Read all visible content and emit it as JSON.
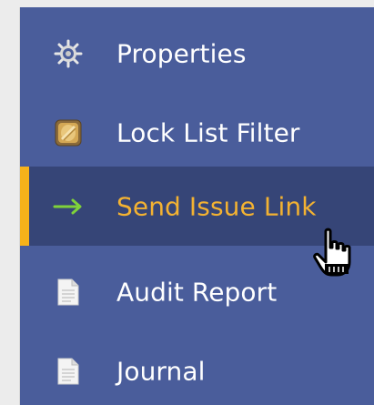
{
  "menu": {
    "items": [
      {
        "label": "Properties",
        "icon": "gear-icon"
      },
      {
        "label": "Lock List Filter",
        "icon": "lock-icon"
      },
      {
        "label": "Send Issue Link",
        "icon": "arrow-right-icon",
        "active": true
      },
      {
        "label": "Audit Report",
        "icon": "document-icon"
      },
      {
        "label": "Journal",
        "icon": "document-icon"
      }
    ]
  },
  "colors": {
    "menu_background": "#4a5d9b",
    "active_background": "#364577",
    "active_text": "#f3b232",
    "active_indicator": "#f6b21a",
    "text": "#ffffff"
  },
  "cursor": {
    "icon": "hand-pointer-cursor-icon"
  }
}
